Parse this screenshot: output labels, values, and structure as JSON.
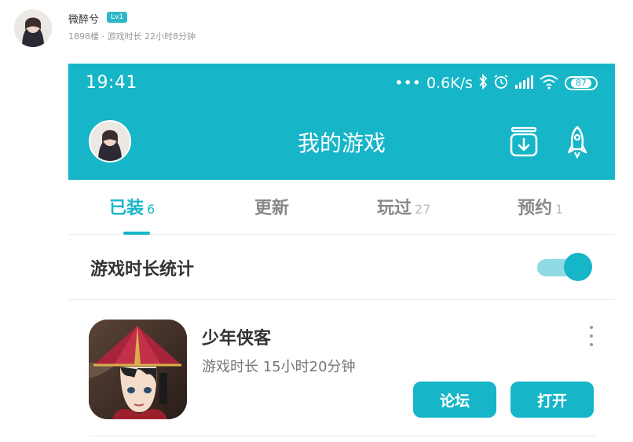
{
  "post": {
    "username": "微醉兮",
    "level": "Lv1",
    "meta": "1898楼 · 游戏时长 22小时8分钟"
  },
  "status_bar": {
    "time": "19:41",
    "network_speed": "0.6K/s",
    "battery": "87",
    "icons": [
      "dots-icon",
      "bluetooth-icon",
      "alarm-icon",
      "signal-icon",
      "wifi-icon",
      "battery-icon"
    ]
  },
  "header": {
    "title": "我的游戏",
    "icons": [
      "download-icon",
      "rocket-icon"
    ]
  },
  "tabs": [
    {
      "label": "已装",
      "count": "6",
      "active": true
    },
    {
      "label": "更新",
      "count": "",
      "active": false
    },
    {
      "label": "玩过",
      "count": "27",
      "active": false
    },
    {
      "label": "预约",
      "count": "1",
      "active": false
    }
  ],
  "stats": {
    "label": "游戏时长统计",
    "toggle_on": true
  },
  "game": {
    "name": "少年侠客",
    "playtime": "游戏时长 15小时20分钟",
    "forum_label": "论坛",
    "open_label": "打开"
  },
  "colors": {
    "accent": "#16b5c8",
    "accent_light": "#8fdbe4",
    "text_dark": "#333333",
    "text_muted": "#888888"
  }
}
